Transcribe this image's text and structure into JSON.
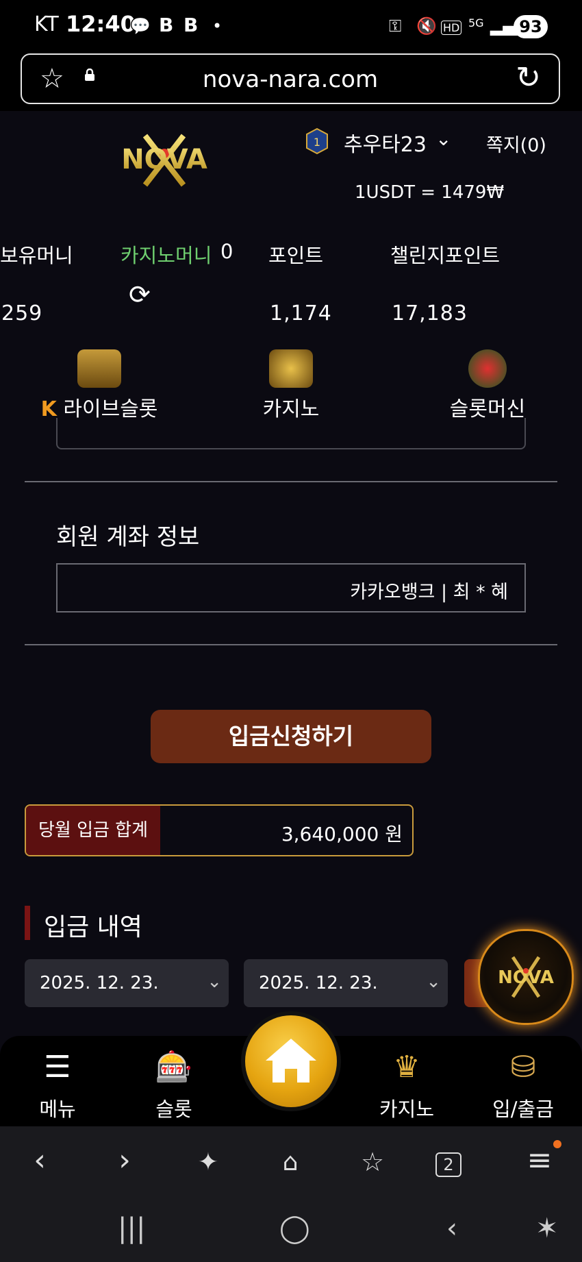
{
  "status_bar": {
    "carrier": "KT",
    "time": "12:40",
    "battery": "93",
    "icons": [
      "talk-icon",
      "b-icon",
      "b-icon",
      "dot-icon",
      "key-icon",
      "mute-icon",
      "hd-icon",
      "5g-icon",
      "signal-icon"
    ]
  },
  "browser": {
    "url": "nova-nara.com",
    "tab_count": "2"
  },
  "header": {
    "logo_text": "NOVA",
    "rank": "1",
    "username": "추우타23",
    "messages": "쪽지(0)",
    "exchange_rate": "1USDT = 1479₩"
  },
  "balances": {
    "holding_label": "보유머니",
    "holding_value": "259",
    "casino_label": "카지노머니",
    "casino_value": "0",
    "point_label": "포인트",
    "point_value": "1,174",
    "challenge_label": "챌린지포인트",
    "challenge_value": "17,183"
  },
  "categories": [
    {
      "label": "라이브슬롯",
      "icon": "live-slot-icon"
    },
    {
      "label": "카지노",
      "icon": "k-slot-icon"
    },
    {
      "label": "슬롯머신",
      "icon": "777-slots-icon"
    }
  ],
  "account": {
    "title": "회원 계좌 정보",
    "value": "카카오뱅크 | 최 * 혜"
  },
  "deposit_button": "입금신청하기",
  "monthly_sum": {
    "label": "당월 입금 합계",
    "value": "3,640,000 원"
  },
  "history": {
    "title": "입금 내역",
    "date_from": "2025. 12. 23.",
    "date_to": "2025. 12. 23."
  },
  "bottom_nav": [
    {
      "label": "메뉴",
      "icon": "menu-icon"
    },
    {
      "label": "슬롯",
      "icon": "slot-machine-icon"
    },
    {
      "label": "",
      "icon": "home-icon"
    },
    {
      "label": "카지노",
      "icon": "k-slot-icon"
    },
    {
      "label": "입/출금",
      "icon": "coins-icon"
    }
  ],
  "colors": {
    "background": "#0b0a12",
    "deposit_button": "#6b2a14",
    "casino_money": "#6fcf6f",
    "sum_border": "#c99b3c",
    "home_button": "#e5a410"
  }
}
